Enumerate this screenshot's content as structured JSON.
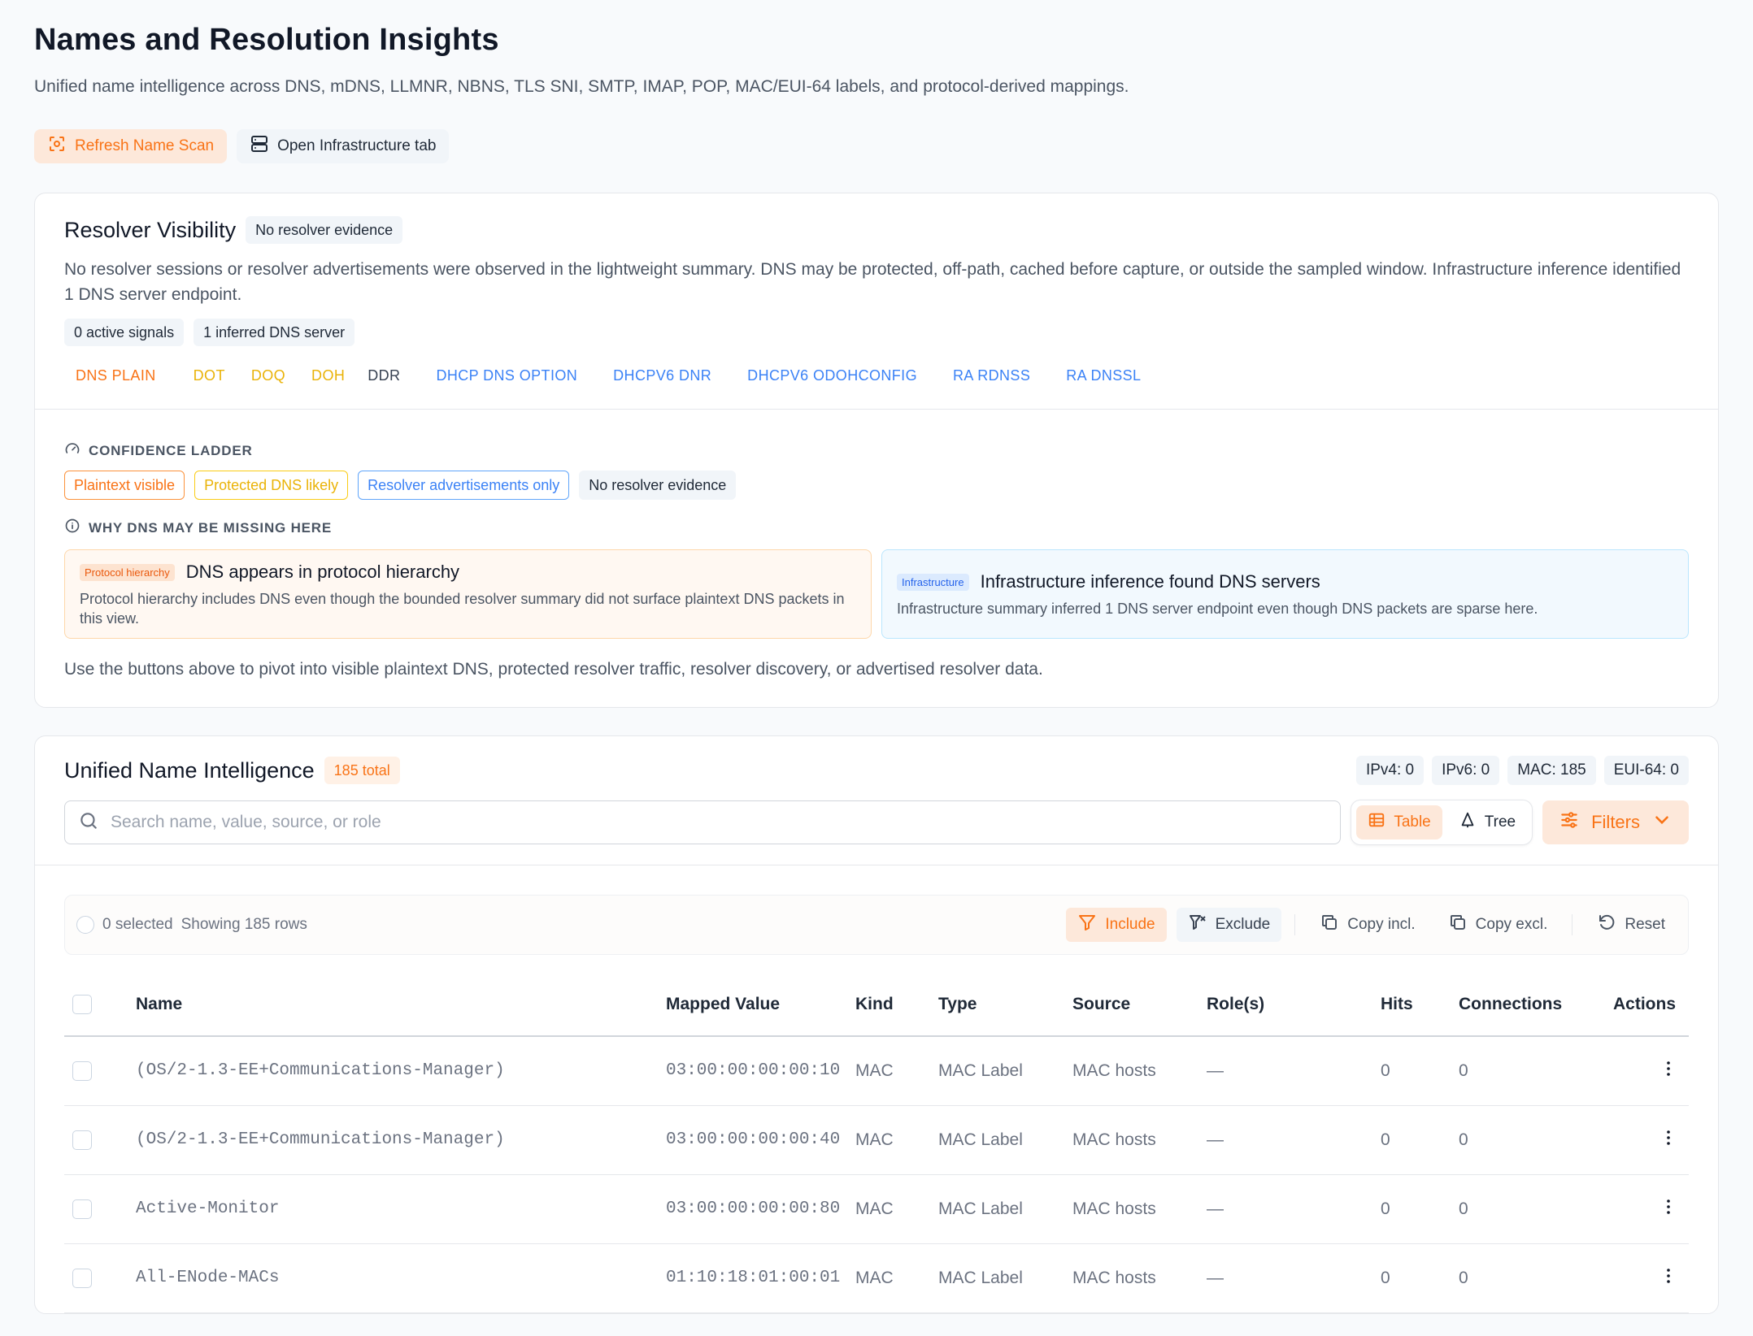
{
  "header": {
    "title": "Names and Resolution Insights",
    "subtitle": "Unified name intelligence across DNS, mDNS, LLMNR, NBNS, TLS SNI, SMTP, IMAP, POP, MAC/EUI-64 labels, and protocol-derived mappings."
  },
  "actions": {
    "refresh_label": "Refresh Name Scan",
    "infra_label": "Open Infrastructure tab"
  },
  "colors": {
    "accent": "#f97316",
    "warning": "#eab308",
    "info": "#3b82f6"
  },
  "resolver": {
    "title": "Resolver Visibility",
    "status_chip": "No resolver evidence",
    "description": "No resolver sessions or resolver advertisements were observed in the lightweight summary. DNS may be protected, off-path, cached before capture, or outside the sampled window. Infrastructure inference identified 1 DNS server endpoint.",
    "chips": [
      "0 active signals",
      "1 inferred DNS server"
    ],
    "protocols": [
      {
        "label": "DNS PLAIN",
        "color": "#f97316"
      },
      {
        "label": "DOT",
        "color": "#eab308"
      },
      {
        "label": "DOQ",
        "color": "#eab308"
      },
      {
        "label": "DOH",
        "color": "#eab308"
      },
      {
        "label": "DDR",
        "color": "#374151"
      },
      {
        "label": "DHCP DNS OPTION",
        "color": "#3b82f6"
      },
      {
        "label": "DHCPV6 DNR",
        "color": "#3b82f6"
      },
      {
        "label": "DHCPV6 ODOHCONFIG",
        "color": "#3b82f6"
      },
      {
        "label": "RA RDNSS",
        "color": "#3b82f6"
      },
      {
        "label": "RA DNSSL",
        "color": "#3b82f6"
      }
    ],
    "ladder_label": "CONFIDENCE LADDER",
    "ladder": [
      "Plaintext visible",
      "Protected DNS likely",
      "Resolver advertisements only",
      "No resolver evidence"
    ],
    "missing_label": "WHY DNS MAY BE MISSING HERE",
    "reasons": [
      {
        "tag": "Protocol hierarchy",
        "title": "DNS appears in protocol hierarchy",
        "body": "Protocol hierarchy includes DNS even though the bounded resolver summary did not surface plaintext DNS packets in this view."
      },
      {
        "tag": "Infrastructure",
        "title": "Infrastructure inference found DNS servers",
        "body": "Infrastructure summary inferred 1 DNS server endpoint even though DNS packets are sparse here."
      }
    ],
    "foot_note": "Use the buttons above to pivot into visible plaintext DNS, protected resolver traffic, resolver discovery, or advertised resolver data."
  },
  "unified": {
    "title": "Unified Name Intelligence",
    "total_badge": "185 total",
    "counters": [
      "IPv4: 0",
      "IPv6: 0",
      "MAC: 185",
      "EUI-64: 0"
    ],
    "search_placeholder": "Search name, value, source, or role",
    "view_table": "Table",
    "view_tree": "Tree",
    "filters_label": "Filters",
    "toolbar": {
      "selected": "0 selected",
      "showing": "Showing 185 rows",
      "include": "Include",
      "exclude": "Exclude",
      "copy_incl": "Copy incl.",
      "copy_excl": "Copy excl.",
      "reset": "Reset"
    },
    "columns": [
      "Name",
      "Mapped Value",
      "Kind",
      "Type",
      "Source",
      "Role(s)",
      "Hits",
      "Connections",
      "Actions"
    ],
    "rows": [
      {
        "name": "(OS/2-1.3-EE+Communications-Manager)",
        "value": "03:00:00:00:00:10",
        "kind": "MAC",
        "type": "MAC Label",
        "source": "MAC hosts",
        "roles": "—",
        "hits": "0",
        "connections": "0"
      },
      {
        "name": "(OS/2-1.3-EE+Communications-Manager)",
        "value": "03:00:00:00:00:40",
        "kind": "MAC",
        "type": "MAC Label",
        "source": "MAC hosts",
        "roles": "—",
        "hits": "0",
        "connections": "0"
      },
      {
        "name": "Active-Monitor",
        "value": "03:00:00:00:00:80",
        "kind": "MAC",
        "type": "MAC Label",
        "source": "MAC hosts",
        "roles": "—",
        "hits": "0",
        "connections": "0"
      },
      {
        "name": "All-ENode-MACs",
        "value": "01:10:18:01:00:01",
        "kind": "MAC",
        "type": "MAC Label",
        "source": "MAC hosts",
        "roles": "—",
        "hits": "0",
        "connections": "0"
      }
    ]
  }
}
